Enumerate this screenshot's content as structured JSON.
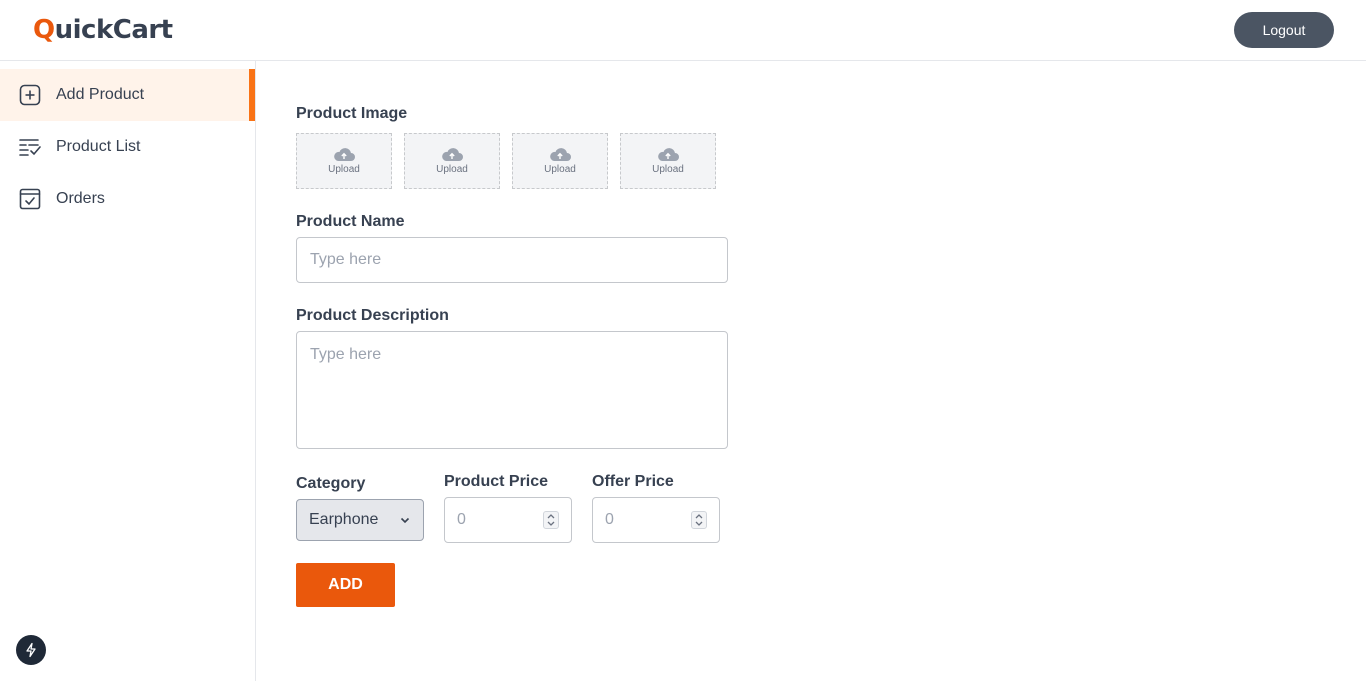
{
  "header": {
    "logo_first": "Q",
    "logo_rest": "uickCart",
    "logout_label": "Logout"
  },
  "sidebar": {
    "items": [
      {
        "label": "Add Product",
        "icon": "add-square-icon",
        "active": true
      },
      {
        "label": "Product List",
        "icon": "list-check-icon",
        "active": false
      },
      {
        "label": "Orders",
        "icon": "order-checkbox-icon",
        "active": false
      }
    ]
  },
  "form": {
    "image_label": "Product Image",
    "upload_label": "Upload",
    "name_label": "Product Name",
    "name_placeholder": "Type here",
    "description_label": "Product Description",
    "description_placeholder": "Type here",
    "category_label": "Category",
    "category_value": "Earphone",
    "price_label": "Product Price",
    "price_value": "0",
    "offer_label": "Offer Price",
    "offer_value": "0",
    "submit_label": "ADD"
  },
  "colors": {
    "accent": "#ea580c",
    "active_bg": "#fff3ea",
    "logout_bg": "#4b5563"
  }
}
